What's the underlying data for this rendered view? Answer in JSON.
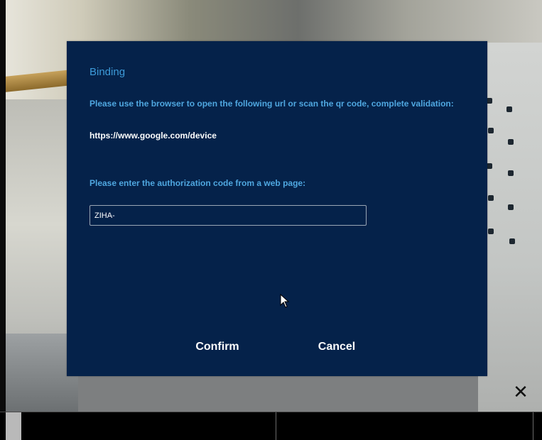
{
  "dialog": {
    "title": "Binding",
    "instruction": "Please use the browser to open the following url or scan the qr code, complete validation:",
    "url": "https://www.google.com/device",
    "code_label": "Please enter the authorization code from a web page:",
    "code_value": "ZIHA-",
    "confirm_label": "Confirm",
    "cancel_label": "Cancel"
  },
  "overlay": {
    "close_symbol": "✕"
  },
  "icons": {
    "pointer": "mouse-pointer-icon",
    "close": "close-icon"
  },
  "colors": {
    "dialog_background": "#05224a",
    "label_blue": "#4fa7e0",
    "title_blue": "#3d9bd9",
    "text_white": "#ffffff"
  }
}
